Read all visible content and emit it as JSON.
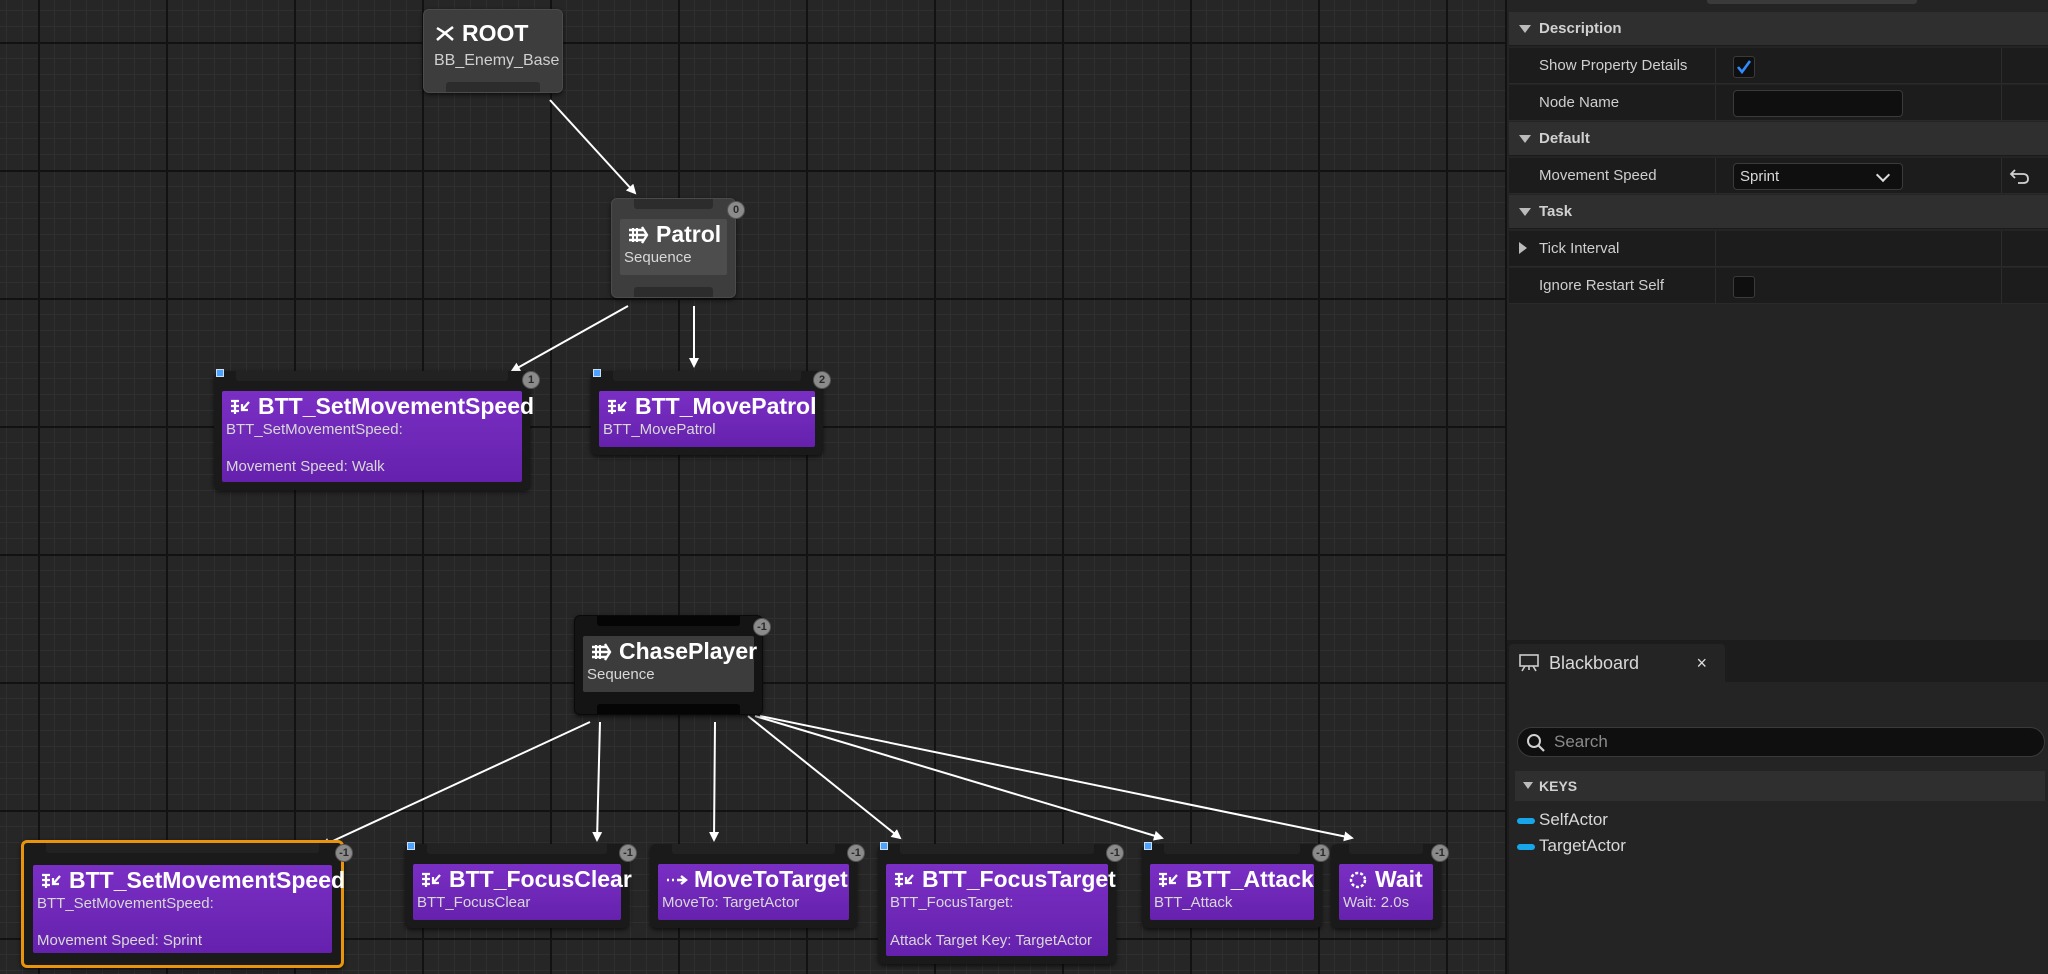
{
  "graph": {
    "nodes": {
      "root": {
        "title": "ROOT",
        "subtitle": "BB_Enemy_Base"
      },
      "patrol": {
        "title": "Patrol",
        "subtitle": "Sequence",
        "index": "0"
      },
      "set_speed_walk": {
        "title": "BTT_SetMovementSpeed",
        "line1": "BTT_SetMovementSpeed:",
        "line2": "Movement Speed: Walk",
        "index": "1"
      },
      "move_patrol": {
        "title": "BTT_MovePatrol",
        "subtitle": "BTT_MovePatrol",
        "index": "2"
      },
      "chase": {
        "title": "ChasePlayer",
        "subtitle": "Sequence",
        "index": "-1"
      },
      "set_speed_sprint": {
        "title": "BTT_SetMovementSpeed",
        "line1": "BTT_SetMovementSpeed:",
        "line2": "Movement Speed: Sprint",
        "index": "-1"
      },
      "focus_clear": {
        "title": "BTT_FocusClear",
        "subtitle": "BTT_FocusClear",
        "index": "-1"
      },
      "move_to_target": {
        "title": "MoveToTarget",
        "subtitle": "MoveTo: TargetActor",
        "index": "-1"
      },
      "focus_target": {
        "title": "BTT_FocusTarget",
        "line1": "BTT_FocusTarget:",
        "line2": "Attack Target Key: TargetActor",
        "index": "-1"
      },
      "attack": {
        "title": "BTT_Attack",
        "subtitle": "BTT_Attack",
        "index": "-1"
      },
      "wait": {
        "title": "Wait",
        "subtitle": "Wait: 2.0s",
        "index": "-1"
      }
    }
  },
  "details": {
    "sections": {
      "description": "Description",
      "default": "Default",
      "task": "Task"
    },
    "rows": {
      "show_property_details": {
        "label": "Show Property Details",
        "checked": true
      },
      "node_name": {
        "label": "Node Name",
        "value": ""
      },
      "movement_speed": {
        "label": "Movement Speed",
        "value": "Sprint"
      },
      "tick_interval": {
        "label": "Tick Interval"
      },
      "ignore_restart_self": {
        "label": "Ignore Restart Self",
        "checked": false
      }
    }
  },
  "blackboard": {
    "tab_label": "Blackboard",
    "close_glyph": "×",
    "search_placeholder": "Search",
    "keys_header": "KEYS",
    "keys": [
      "SelfActor",
      "TargetActor"
    ]
  },
  "colors": {
    "task_purple": "#6e27b8",
    "selection_orange": "#e8940c",
    "key_blue": "#17a6ea",
    "check_blue": "#2f8cff"
  }
}
